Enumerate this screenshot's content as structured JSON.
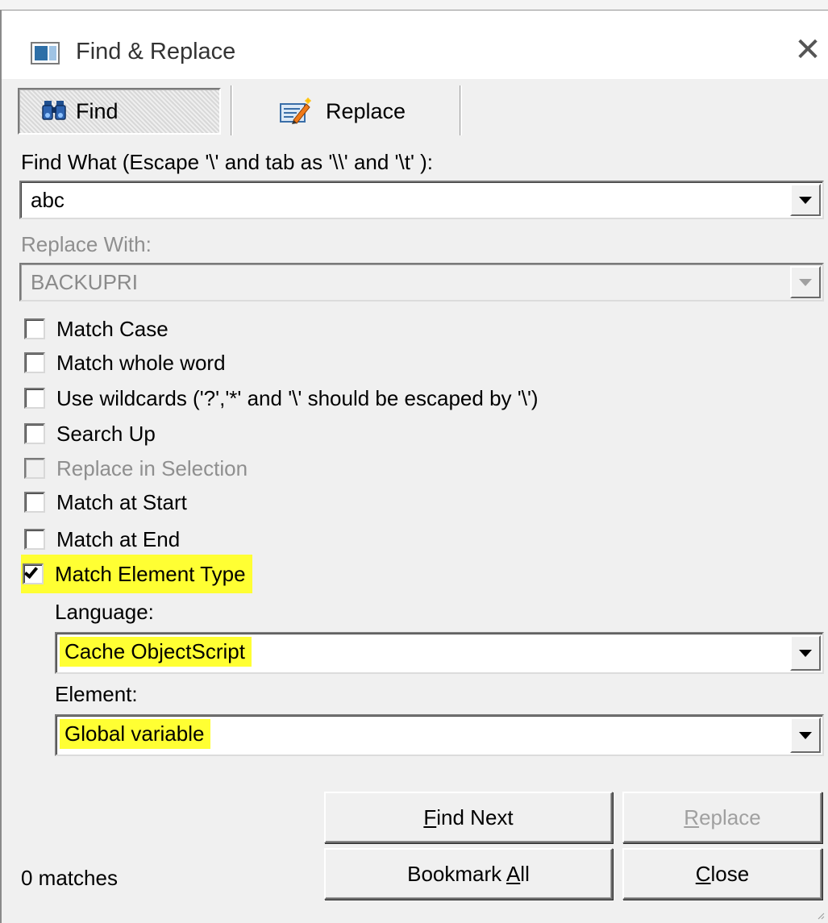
{
  "window": {
    "title": "Find & Replace",
    "icon": "app-window-icon",
    "close_icon": "close-x-icon"
  },
  "tabs": [
    {
      "label": "Find",
      "icon": "binoculars-icon",
      "selected": true
    },
    {
      "label": "Replace",
      "icon": "replace-icon",
      "selected": false
    }
  ],
  "find_what": {
    "label": "Find What (Escape '\\' and tab as '\\\\' and '\\t' ):",
    "value": "abc"
  },
  "replace_with": {
    "label": "Replace With:",
    "value": "BACKUPRI",
    "disabled": true
  },
  "options": [
    {
      "label": "Match Case",
      "checked": false,
      "disabled": false
    },
    {
      "label": "Match whole word",
      "checked": false,
      "disabled": false
    },
    {
      "label": "Use wildcards ('?','*' and '\\' should be escaped by '\\')",
      "checked": false,
      "disabled": false
    },
    {
      "label": "Search Up",
      "checked": false,
      "disabled": false
    },
    {
      "label": "Replace in Selection",
      "checked": false,
      "disabled": true
    },
    {
      "label": "Match at Start",
      "checked": false,
      "disabled": false
    },
    {
      "label": "Match at End",
      "checked": false,
      "disabled": false
    },
    {
      "label": "Match Element Type",
      "checked": true,
      "disabled": false,
      "highlighted": true
    }
  ],
  "language": {
    "label": "Language:",
    "value": "Cache ObjectScript"
  },
  "element": {
    "label": "Element:",
    "value": "Global variable"
  },
  "buttons": {
    "find_next": {
      "mnemonic": "F",
      "rest": "ind Next"
    },
    "replace": {
      "mnemonic": "R",
      "rest": "eplace",
      "disabled": true
    },
    "bookmark_all": {
      "prefix": "Bookmark ",
      "mnemonic": "A",
      "rest": "ll"
    },
    "close": {
      "mnemonic": "C",
      "rest": "lose"
    }
  },
  "status": "0 matches",
  "colors": {
    "highlight": "#ffff33",
    "face": "#f0f0f0",
    "disabled_text": "#8f8f8f"
  }
}
